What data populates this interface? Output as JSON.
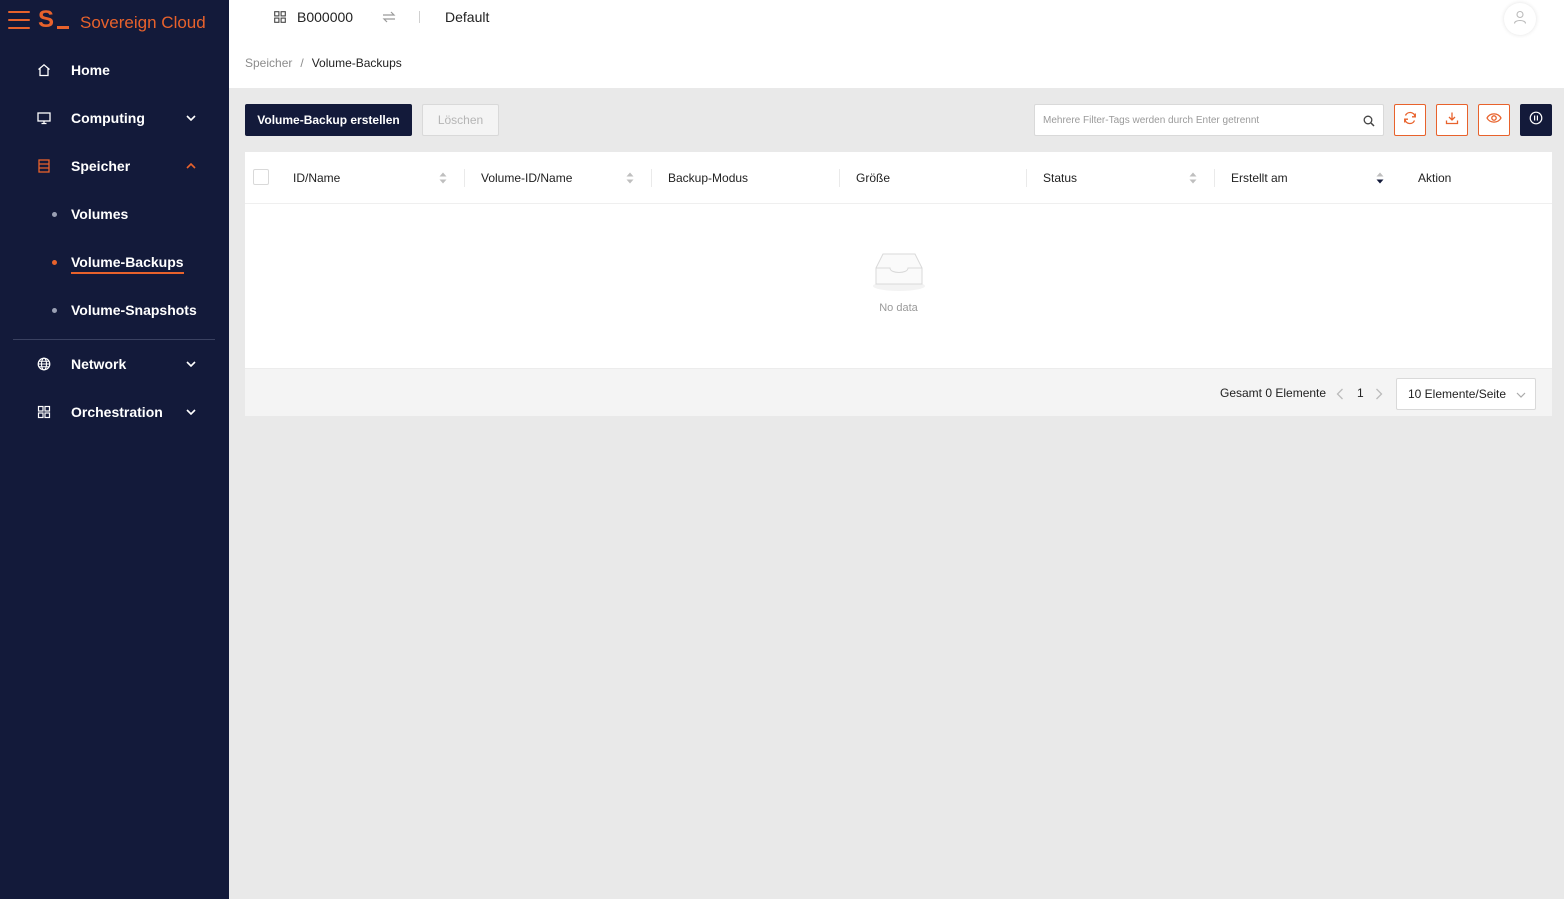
{
  "app": {
    "brand_letter": "S",
    "brand_name": "Sovereign Cloud"
  },
  "colors": {
    "sidebar_bg": "#131a3a",
    "accent": "#e8622c",
    "page_bg": "#e9e9e9"
  },
  "topbar": {
    "project_icon": "grid-icon",
    "project_id": "B000000",
    "swap_icon": "swap-arrows-icon",
    "region": "Default",
    "avatar_icon": "user-icon"
  },
  "sidebar": {
    "items": [
      {
        "label": "Home",
        "icon": "home-icon"
      },
      {
        "label": "Computing",
        "icon": "monitor-icon"
      },
      {
        "label": "Speicher",
        "icon": "storage-icon"
      },
      {
        "label": "Network",
        "icon": "globe-icon"
      },
      {
        "label": "Orchestration",
        "icon": "grid-icon"
      }
    ],
    "sub_items": [
      {
        "label": "Volumes"
      },
      {
        "label": "Volume-Backups"
      },
      {
        "label": "Volume-Snapshots"
      }
    ]
  },
  "breadcrumb": {
    "parent": "Speicher",
    "separator": "/",
    "current": "Volume-Backups"
  },
  "toolbar": {
    "create_label": "Volume-Backup erstellen",
    "delete_label": "Löschen",
    "search_placeholder": "Mehrere Filter-Tags werden durch Enter getrennt",
    "search_icon": "search-icon",
    "refresh_icon": "refresh-icon",
    "download_icon": "download-icon",
    "view_icon": "eye-icon",
    "info_icon": "info-icon"
  },
  "table": {
    "columns": [
      {
        "label": "ID/Name"
      },
      {
        "label": "Volume-ID/Name"
      },
      {
        "label": "Backup-Modus"
      },
      {
        "label": "Größe"
      },
      {
        "label": "Status"
      },
      {
        "label": "Erstellt am"
      },
      {
        "label": "Aktion"
      }
    ],
    "rows": [],
    "empty_text": "No data",
    "empty_icon": "empty-inbox-icon"
  },
  "pagination": {
    "total_text": "Gesamt 0 Elemente",
    "current_page": "1",
    "page_size": "10 Elemente/Seite"
  }
}
